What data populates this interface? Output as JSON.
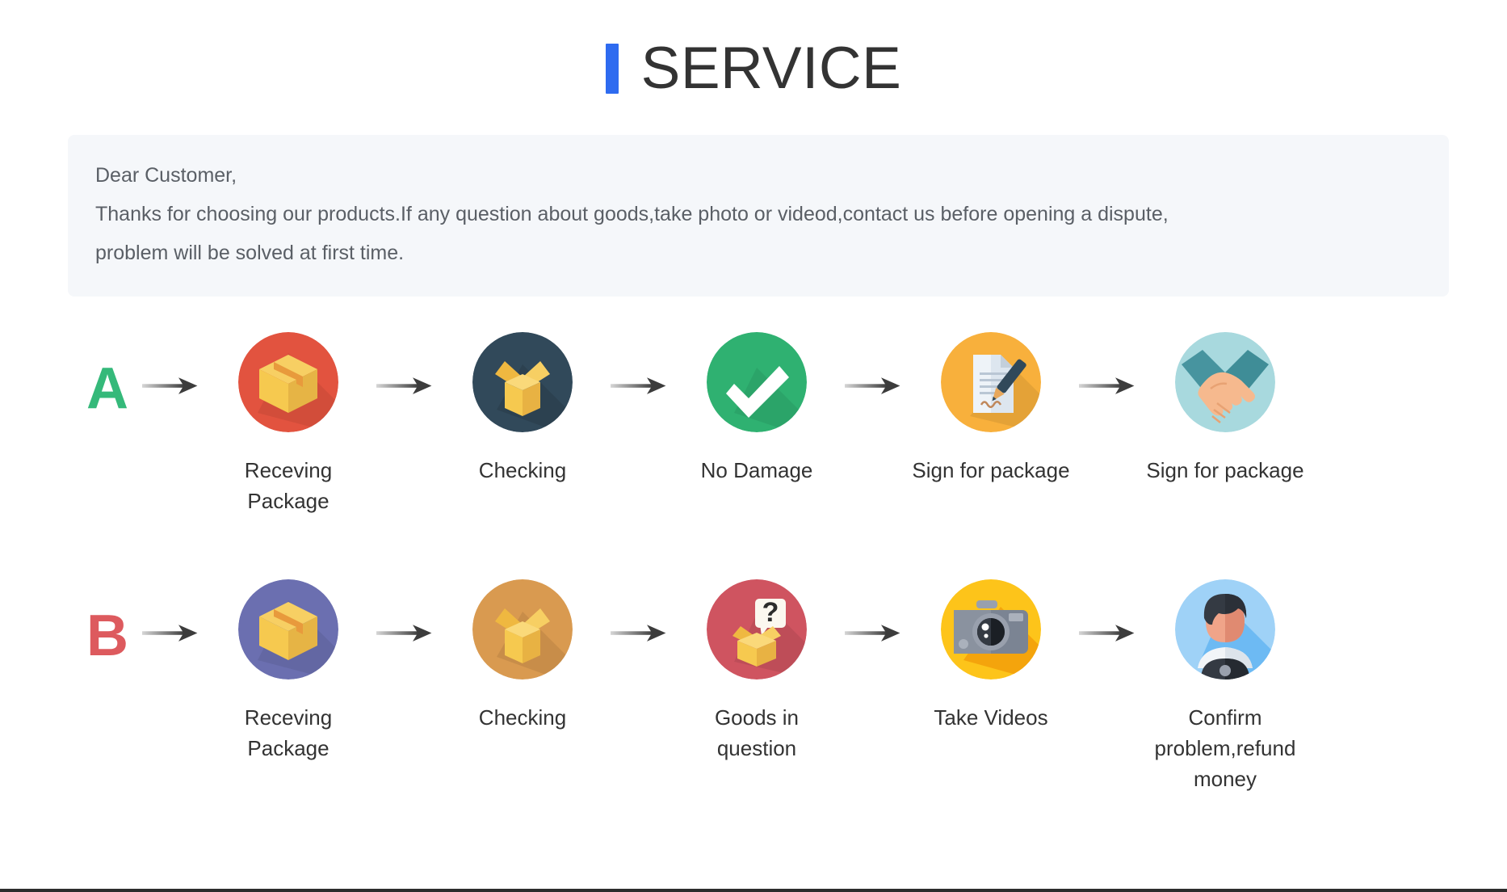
{
  "header": {
    "title": "SERVICE",
    "accent_color": "#2e6bf0"
  },
  "notice": {
    "line1": "Dear Customer,",
    "line2": "Thanks for choosing our products.If any question about goods,take photo or videod,contact us before opening a dispute,",
    "line3": "problem will be solved at first time.",
    "background_color": "#f5f7fa"
  },
  "flows": [
    {
      "letter": "A",
      "letter_color": "#35b97a",
      "arrow_glyph": "→",
      "steps": [
        {
          "label": "Receving Package",
          "icon": "package-box-icon",
          "circle_color": "#e2533f"
        },
        {
          "label": "Checking",
          "icon": "open-box-icon",
          "circle_color": "#31495a"
        },
        {
          "label": "No Damage",
          "icon": "check-mark-icon",
          "circle_color": "#2fb171"
        },
        {
          "label": "Sign for package",
          "icon": "document-pen-icon",
          "circle_color": "#f8b03c"
        },
        {
          "label": "Sign for package",
          "icon": "handshake-icon",
          "circle_color": "#a8d9de"
        }
      ]
    },
    {
      "letter": "B",
      "letter_color": "#dd5a5e",
      "arrow_glyph": "→",
      "steps": [
        {
          "label": "Receving Package",
          "icon": "package-box-icon",
          "circle_color": "#6b6fb0"
        },
        {
          "label": "Checking",
          "icon": "open-box-icon",
          "circle_color": "#d99a50"
        },
        {
          "label": "Goods in question",
          "icon": "question-box-icon",
          "circle_color": "#cf5460"
        },
        {
          "label": "Take Videos",
          "icon": "camera-icon",
          "circle_color": "#fdc41a"
        },
        {
          "label": "Confirm problem,refund money",
          "icon": "support-person-icon",
          "circle_color": "#9fd2f7"
        }
      ]
    }
  ]
}
